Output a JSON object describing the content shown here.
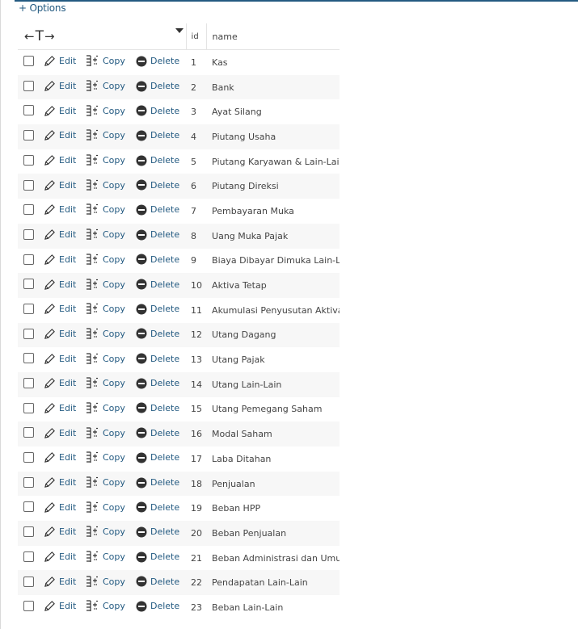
{
  "options_link": "+ Options",
  "header": {
    "sort_glyph_left": "←",
    "sort_glyph_mid": "T",
    "sort_glyph_right": "→",
    "col_id": "id",
    "col_name": "name"
  },
  "actions": {
    "edit": "Edit",
    "copy": "Copy",
    "delete": "Delete"
  },
  "colors": {
    "link": "#235a81",
    "row_alt": "#f7f7f7",
    "delete_icon": "#333333"
  },
  "rows": [
    {
      "id": "1",
      "name": "Kas"
    },
    {
      "id": "2",
      "name": "Bank"
    },
    {
      "id": "3",
      "name": "Ayat Silang"
    },
    {
      "id": "4",
      "name": "Piutang Usaha"
    },
    {
      "id": "5",
      "name": "Piutang Karyawan & Lain-Lain"
    },
    {
      "id": "6",
      "name": "Piutang Direksi"
    },
    {
      "id": "7",
      "name": "Pembayaran Muka"
    },
    {
      "id": "8",
      "name": "Uang Muka Pajak"
    },
    {
      "id": "9",
      "name": "Biaya Dibayar Dimuka Lain-Lain"
    },
    {
      "id": "10",
      "name": "Aktiva Tetap"
    },
    {
      "id": "11",
      "name": "Akumulasi Penyusutan Aktiva"
    },
    {
      "id": "12",
      "name": "Utang Dagang"
    },
    {
      "id": "13",
      "name": "Utang Pajak"
    },
    {
      "id": "14",
      "name": "Utang Lain-Lain"
    },
    {
      "id": "15",
      "name": "Utang Pemegang Saham"
    },
    {
      "id": "16",
      "name": "Modal Saham"
    },
    {
      "id": "17",
      "name": "Laba Ditahan"
    },
    {
      "id": "18",
      "name": "Penjualan"
    },
    {
      "id": "19",
      "name": "Beban HPP"
    },
    {
      "id": "20",
      "name": "Beban Penjualan"
    },
    {
      "id": "21",
      "name": "Beban Administrasi dan Umum"
    },
    {
      "id": "22",
      "name": "Pendapatan Lain-Lain"
    },
    {
      "id": "23",
      "name": "Beban Lain-Lain"
    }
  ]
}
